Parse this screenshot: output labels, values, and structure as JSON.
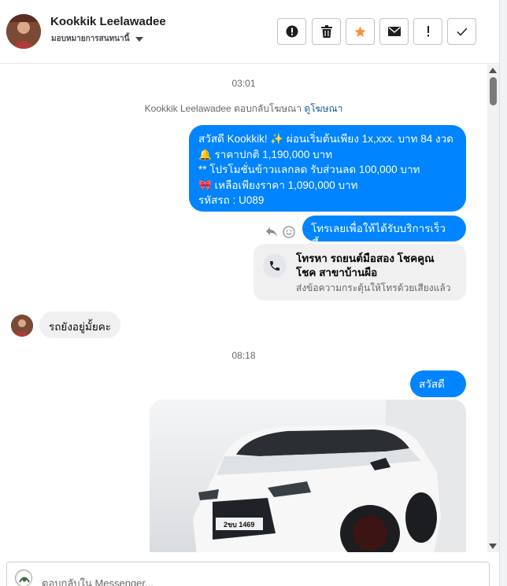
{
  "header": {
    "name": "Kookkik Leelawadee",
    "subtitle": "มอบหมายการสนทนานี้"
  },
  "toolbar": {
    "buttons": [
      {
        "icon": "report-icon"
      },
      {
        "icon": "trash-icon"
      },
      {
        "icon": "star-icon",
        "color": "#f7923a"
      },
      {
        "icon": "mail-icon"
      },
      {
        "icon": "exclamation-icon"
      },
      {
        "icon": "check-icon"
      }
    ]
  },
  "chat": {
    "timestamp_1": "03:01",
    "notice_prefix": "Kookkik Leelawadee ตอบกลับโฆษณา",
    "notice_link": "ดูโฆษณา",
    "ad_message_lines": [
      "สวัสดี Kookkik! ✨  ผ่อนเริ่มต้นเพียง 1x,xxx. บาท 84 งวด",
      "🔔  ราคาปกติ 1,190,000 บาท",
      "** โปรโมชั่นข้าวแลกลด รับส่วนลด 100,000 บาท",
      "🎀  เหลือเพียงราคา 1,090,000 บาท",
      " รหัสรถ : U089"
    ],
    "call_cta": "โทรเลยเพื่อให้ได้รับบริการเร็วขึ้น",
    "call_card_title": "โทรหา รถยนต์มือสอง โชคคูณโชค สาขาบ้านผือ",
    "call_card_sub": "ส่งข้อความกระตุ้นให้โทรด้วยเสียงแล้ว",
    "incoming_message": "รถยังอยู่มั้ยคะ",
    "timestamp_2": "08:18",
    "outgoing_greeting": "สวัสดีคะ",
    "photo_plate": "2ขบ 1469"
  },
  "composer": {
    "placeholder": "ตอบกลับใน Messenger..."
  },
  "colors": {
    "bubble_out": "#0084ff",
    "bubble_in": "#f0f0f0",
    "link": "#1a5fa6"
  }
}
